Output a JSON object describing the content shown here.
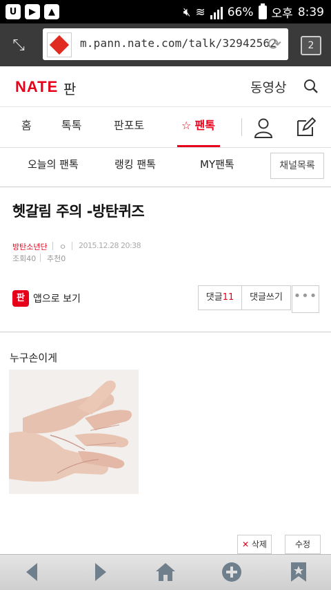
{
  "status_bar": {
    "battery": "66%",
    "ampm": "오후",
    "time": "8:39"
  },
  "browser": {
    "url": "m.pann.nate.com/talk/32942562",
    "tab_count": "2"
  },
  "header": {
    "logo": "NATE",
    "logo_suffix": "판",
    "video_link": "동영상"
  },
  "main_nav": {
    "home": "홈",
    "toktok": "톡톡",
    "panpoto": "판포토",
    "pantok": "팬톡"
  },
  "sub_nav": {
    "today": "오늘의 팬톡",
    "ranking": "랭킹 팬톡",
    "my": "MY팬톡",
    "channel_list": "채널목록"
  },
  "article": {
    "title": "헷갈림 주의 -방탄퀴즈",
    "author": "방탄소년단",
    "marker": "ㅇ",
    "date": "2015.12.28 20:38",
    "views": "조회40",
    "recommends": "추천0",
    "app_view": "앱으로 보기",
    "app_icon": "판",
    "comment_label": "댓글",
    "comment_count": "11",
    "write_comment": "댓글쓰기",
    "more": "•••",
    "body": "누구손이게",
    "delete": "삭제",
    "edit": "수정"
  },
  "colors": {
    "brand": "#e6001a"
  }
}
